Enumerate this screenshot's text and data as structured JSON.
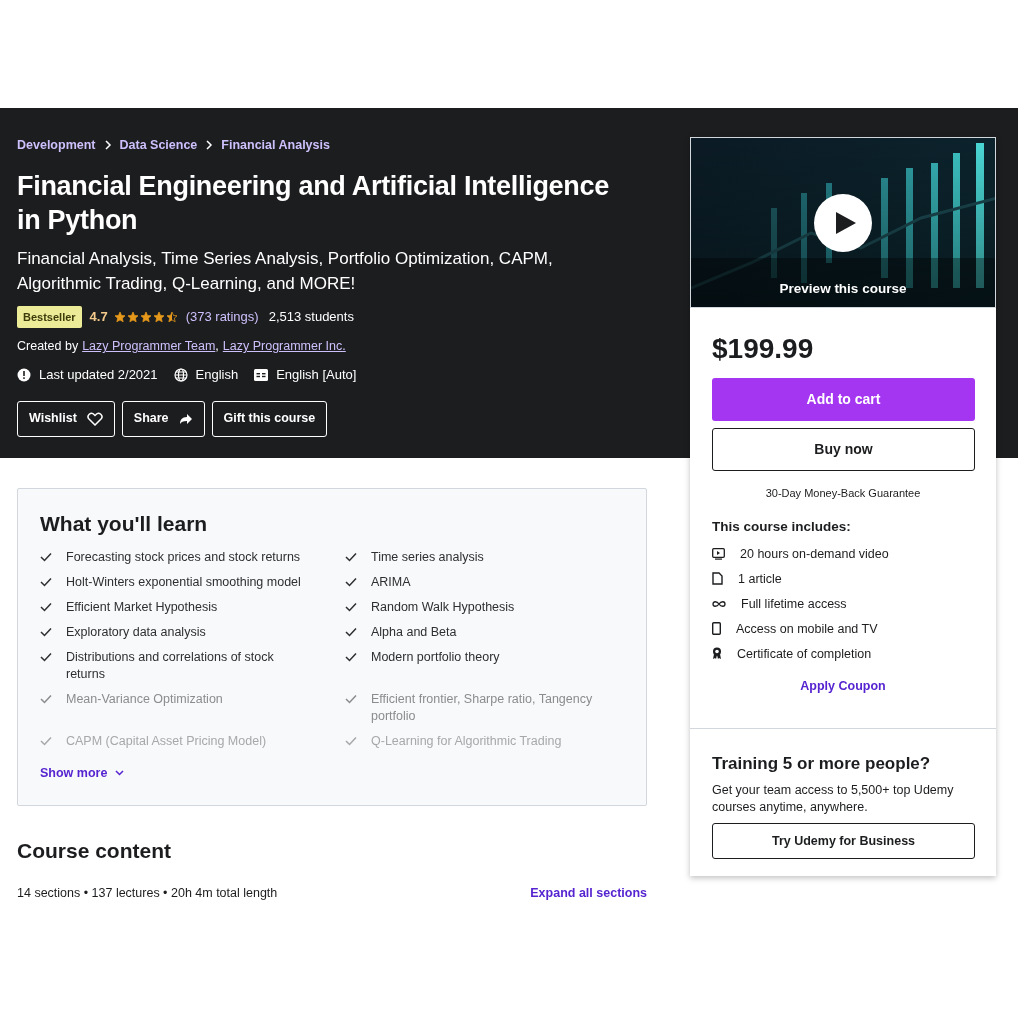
{
  "breadcrumbs": [
    "Development",
    "Data Science",
    "Financial Analysis"
  ],
  "title": "Financial Engineering and Artificial Intelligence in Python",
  "subtitle": "Financial Analysis, Time Series Analysis, Portfolio Optimization, CAPM, Algorithmic Trading, Q-Learning, and MORE!",
  "badge": "Bestseller",
  "rating": "4.7",
  "stars": 4.5,
  "ratings_count": "(373 ratings)",
  "students": "2,513 students",
  "created_by_label": "Created by",
  "authors": [
    "Lazy Programmer Team",
    "Lazy Programmer Inc."
  ],
  "author_separator": ",",
  "meta": [
    {
      "kind": "updated",
      "text": "Last updated 2/2021"
    },
    {
      "kind": "language",
      "text": "English"
    },
    {
      "kind": "captions",
      "text": "English [Auto]"
    }
  ],
  "actions": [
    {
      "label": "Wishlist",
      "kind": "wishlist"
    },
    {
      "label": "Share",
      "kind": "share"
    },
    {
      "label": "Gift this course",
      "kind": "gift"
    }
  ],
  "learn": {
    "title": "What you'll learn",
    "items": [
      {
        "text": "Forecasting stock prices and stock returns",
        "kind": "normal"
      },
      {
        "text": "Time series analysis",
        "kind": "normal"
      },
      {
        "text": "Holt-Winters exponential smoothing model",
        "kind": "normal"
      },
      {
        "text": "ARIMA",
        "kind": "normal"
      },
      {
        "text": "Efficient Market Hypothesis",
        "kind": "normal"
      },
      {
        "text": "Random Walk Hypothesis",
        "kind": "normal"
      },
      {
        "text": "Exploratory data analysis",
        "kind": "normal"
      },
      {
        "text": "Alpha and Beta",
        "kind": "normal"
      },
      {
        "text": "Distributions and correlations of stock returns",
        "kind": "normal"
      },
      {
        "text": "Modern portfolio theory",
        "kind": "normal"
      },
      {
        "text": "Mean-Variance Optimization",
        "kind": "faded"
      },
      {
        "text": "Efficient frontier, Sharpe ratio, Tangency portfolio",
        "kind": "faded"
      },
      {
        "text": "CAPM (Capital Asset Pricing Model)",
        "kind": "fainter"
      },
      {
        "text": "Q-Learning for Algorithmic Trading",
        "kind": "fainter"
      }
    ],
    "show_more": "Show more"
  },
  "content": {
    "title": "Course content",
    "summary": "14 sections • 137 lectures • 20h 4m total length",
    "expand": "Expand all sections"
  },
  "card": {
    "preview": "Preview this course",
    "price": "$199.99",
    "add_to_cart": "Add to cart",
    "buy_now": "Buy now",
    "guarantee": "30-Day Money-Back Guarantee",
    "includes_title": "This course includes:",
    "includes": [
      {
        "kind": "video",
        "text": "20 hours on-demand video"
      },
      {
        "kind": "article",
        "text": "1 article"
      },
      {
        "kind": "infinity",
        "text": "Full lifetime access"
      },
      {
        "kind": "mobile",
        "text": "Access on mobile and TV"
      },
      {
        "kind": "certificate",
        "text": "Certificate of completion"
      }
    ],
    "coupon": "Apply Coupon",
    "training_title": "Training 5 or more people?",
    "training_text": "Get your team access to 5,500+ top Udemy courses anytime, anywhere.",
    "business": "Try Udemy for Business"
  }
}
